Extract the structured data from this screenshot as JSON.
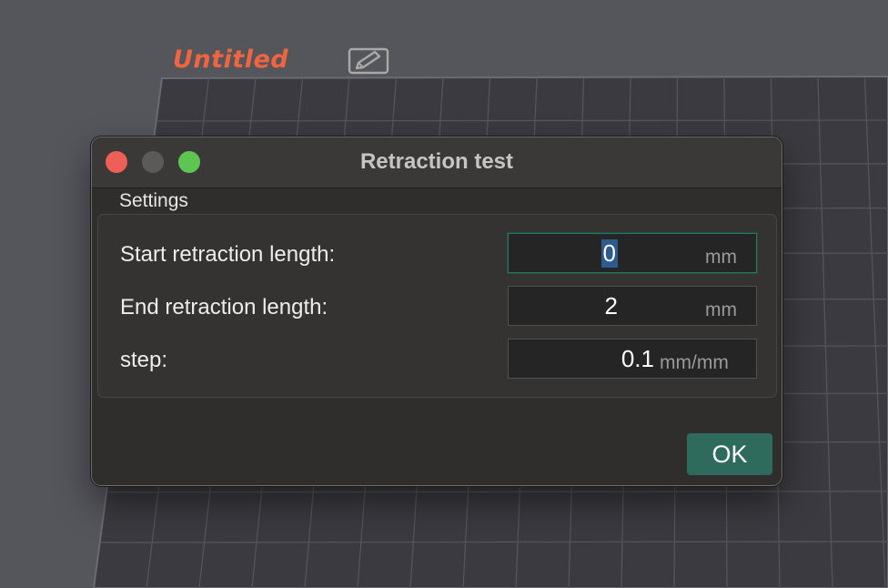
{
  "project": {
    "title": "Untitled",
    "edit_icon": "edit-pencil-icon",
    "title_color": "#f0653f"
  },
  "dialog": {
    "title": "Retraction test",
    "window_controls": [
      "close",
      "minimize",
      "maximize"
    ],
    "group_label": "Settings",
    "rows": [
      {
        "label": "Start retraction length:",
        "value": "0",
        "unit": "mm",
        "focused": true
      },
      {
        "label": "End retraction length:",
        "value": "2",
        "unit": "mm",
        "focused": false
      },
      {
        "label": "step:",
        "value": "0.1",
        "unit": "mm/mm",
        "focused": false
      }
    ],
    "ok_label": "OK",
    "accent_color": "#2e6b5d"
  }
}
